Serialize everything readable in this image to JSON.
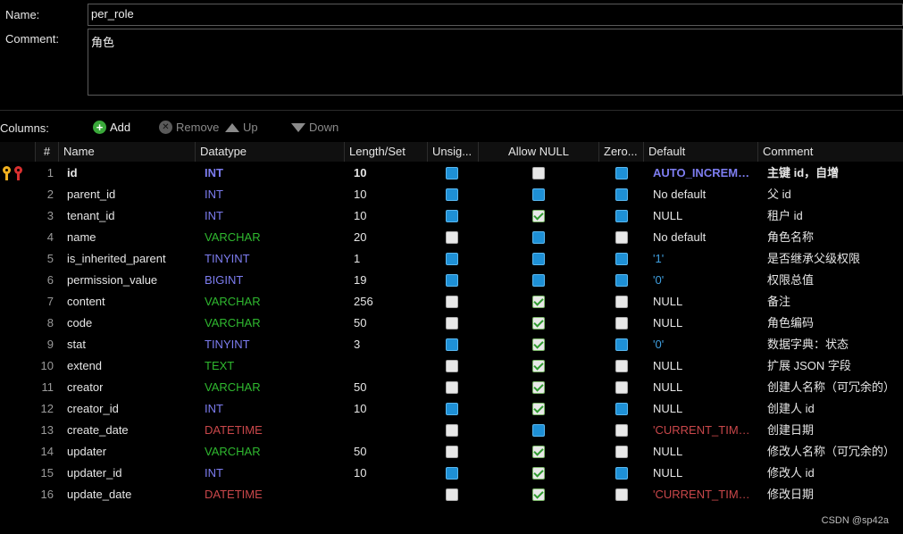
{
  "form": {
    "name_label": "Name:",
    "name_value": "per_role",
    "comment_label": "Comment:",
    "comment_value": "角色"
  },
  "toolbar": {
    "columns_label": "Columns:",
    "add_label": "Add",
    "remove_label": "Remove",
    "up_label": "Up",
    "down_label": "Down"
  },
  "table": {
    "headers": [
      "#",
      "Name",
      "Datatype",
      "Length/Set",
      "Unsig...",
      "Allow NULL",
      "Zero...",
      "Default",
      "Comment"
    ],
    "rows": [
      {
        "num": "1",
        "name": "id",
        "datatype": "INT",
        "length": "10",
        "unsigned": "blue",
        "allow_null": "white",
        "zerofill": "blue",
        "default": "AUTO_INCREME...",
        "comment": "主键 id，自增"
      },
      {
        "num": "2",
        "name": "parent_id",
        "datatype": "INT",
        "length": "10",
        "unsigned": "blue",
        "allow_null": "blue",
        "zerofill": "blue",
        "default": "No default",
        "comment": "父 id"
      },
      {
        "num": "3",
        "name": "tenant_id",
        "datatype": "INT",
        "length": "10",
        "unsigned": "blue",
        "allow_null": "green",
        "zerofill": "blue",
        "default": "NULL",
        "comment": "租户 id"
      },
      {
        "num": "4",
        "name": "name",
        "datatype": "VARCHAR",
        "length": "20",
        "unsigned": "white",
        "allow_null": "blue",
        "zerofill": "white",
        "default": "No default",
        "comment": "角色名称"
      },
      {
        "num": "5",
        "name": "is_inherited_parent",
        "datatype": "TINYINT",
        "length": "1",
        "unsigned": "blue",
        "allow_null": "blue",
        "zerofill": "blue",
        "default": "'1'",
        "comment": "是否继承父级权限"
      },
      {
        "num": "6",
        "name": "permission_value",
        "datatype": "BIGINT",
        "length": "19",
        "unsigned": "blue",
        "allow_null": "blue",
        "zerofill": "blue",
        "default": "'0'",
        "comment": "权限总值"
      },
      {
        "num": "7",
        "name": "content",
        "datatype": "VARCHAR",
        "length": "256",
        "unsigned": "white",
        "allow_null": "green",
        "zerofill": "white",
        "default": "NULL",
        "comment": "备注"
      },
      {
        "num": "8",
        "name": "code",
        "datatype": "VARCHAR",
        "length": "50",
        "unsigned": "white",
        "allow_null": "green",
        "zerofill": "white",
        "default": "NULL",
        "comment": "角色编码"
      },
      {
        "num": "9",
        "name": "stat",
        "datatype": "TINYINT",
        "length": "3",
        "unsigned": "blue",
        "allow_null": "green",
        "zerofill": "blue",
        "default": "'0'",
        "comment": "数据字典：状态"
      },
      {
        "num": "10",
        "name": "extend",
        "datatype": "TEXT",
        "length": "",
        "unsigned": "white",
        "allow_null": "green",
        "zerofill": "white",
        "default": "NULL",
        "comment": "扩展 JSON 字段"
      },
      {
        "num": "11",
        "name": "creator",
        "datatype": "VARCHAR",
        "length": "50",
        "unsigned": "white",
        "allow_null": "green",
        "zerofill": "white",
        "default": "NULL",
        "comment": "创建人名称（可冗余的）"
      },
      {
        "num": "12",
        "name": "creator_id",
        "datatype": "INT",
        "length": "10",
        "unsigned": "blue",
        "allow_null": "green",
        "zerofill": "blue",
        "default": "NULL",
        "comment": "创建人 id"
      },
      {
        "num": "13",
        "name": "create_date",
        "datatype": "DATETIME",
        "length": "",
        "unsigned": "white",
        "allow_null": "blue",
        "zerofill": "white",
        "default": "'CURRENT_TIMES...",
        "comment": "创建日期"
      },
      {
        "num": "14",
        "name": "updater",
        "datatype": "VARCHAR",
        "length": "50",
        "unsigned": "white",
        "allow_null": "green",
        "zerofill": "white",
        "default": "NULL",
        "comment": "修改人名称（可冗余的）"
      },
      {
        "num": "15",
        "name": "updater_id",
        "datatype": "INT",
        "length": "10",
        "unsigned": "blue",
        "allow_null": "green",
        "zerofill": "blue",
        "default": "NULL",
        "comment": "修改人 id"
      },
      {
        "num": "16",
        "name": "update_date",
        "datatype": "DATETIME",
        "length": "",
        "unsigned": "white",
        "allow_null": "green",
        "zerofill": "white",
        "default": "'CURRENT_TIMES...",
        "comment": "修改日期"
      }
    ]
  },
  "colors": {
    "INT": "#7d7df0",
    "BIGINT": "#7d7df0",
    "TINYINT": "#7d7df0",
    "VARCHAR": "#2fb82f",
    "TEXT": "#2fb82f",
    "DATETIME": "#c9474a",
    "default_text": "#e6e6e6",
    "default_quoted": "#3f9fe0",
    "default_auto": "#7d7df0",
    "default_timestamp": "#c9474a"
  },
  "watermark": "CSDN @sp42a"
}
